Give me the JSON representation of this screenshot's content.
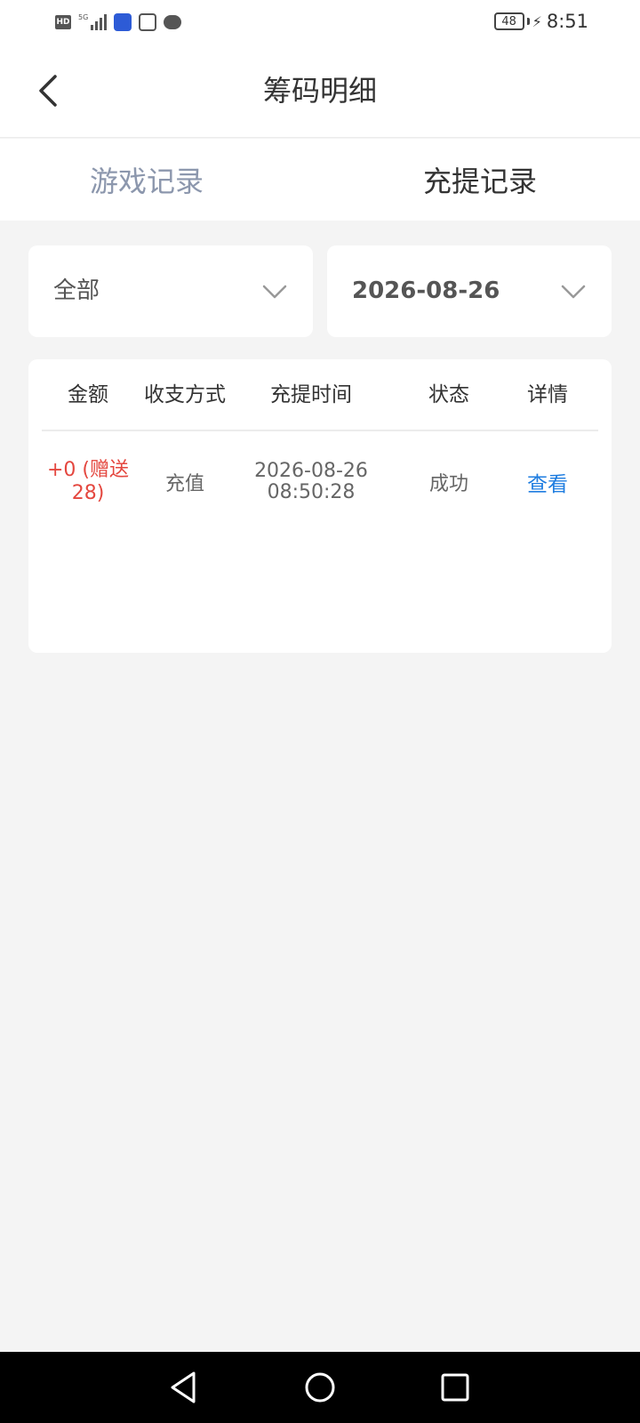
{
  "status_bar": {
    "network_badge": "HD",
    "network_type": "5G",
    "battery": "48",
    "time": "8:51"
  },
  "header": {
    "title": "筹码明细"
  },
  "tabs": [
    {
      "label": "游戏记录",
      "active": false
    },
    {
      "label": "充提记录",
      "active": true
    }
  ],
  "filters": {
    "type_value": "全部",
    "date_value": "2026-08-26"
  },
  "records": {
    "columns": [
      "金额",
      "收支方式",
      "充提时间",
      "状态",
      "详情"
    ],
    "rows": [
      {
        "amount_line1": "+0 (赠送",
        "amount_line2": "28)",
        "method": "充值",
        "date": "2026-08-26",
        "time": "08:50:28",
        "status": "成功",
        "action": "查看"
      }
    ]
  },
  "colors": {
    "accent_link": "#1f7de0",
    "amount_red": "#e4473f",
    "inactive_tab": "#8c97ad",
    "page_background": "#f4f4f4"
  },
  "icons": [
    "back-arrow-icon",
    "chevron-down-icon",
    "nav-back-icon",
    "nav-home-icon",
    "nav-recent-icon"
  ]
}
